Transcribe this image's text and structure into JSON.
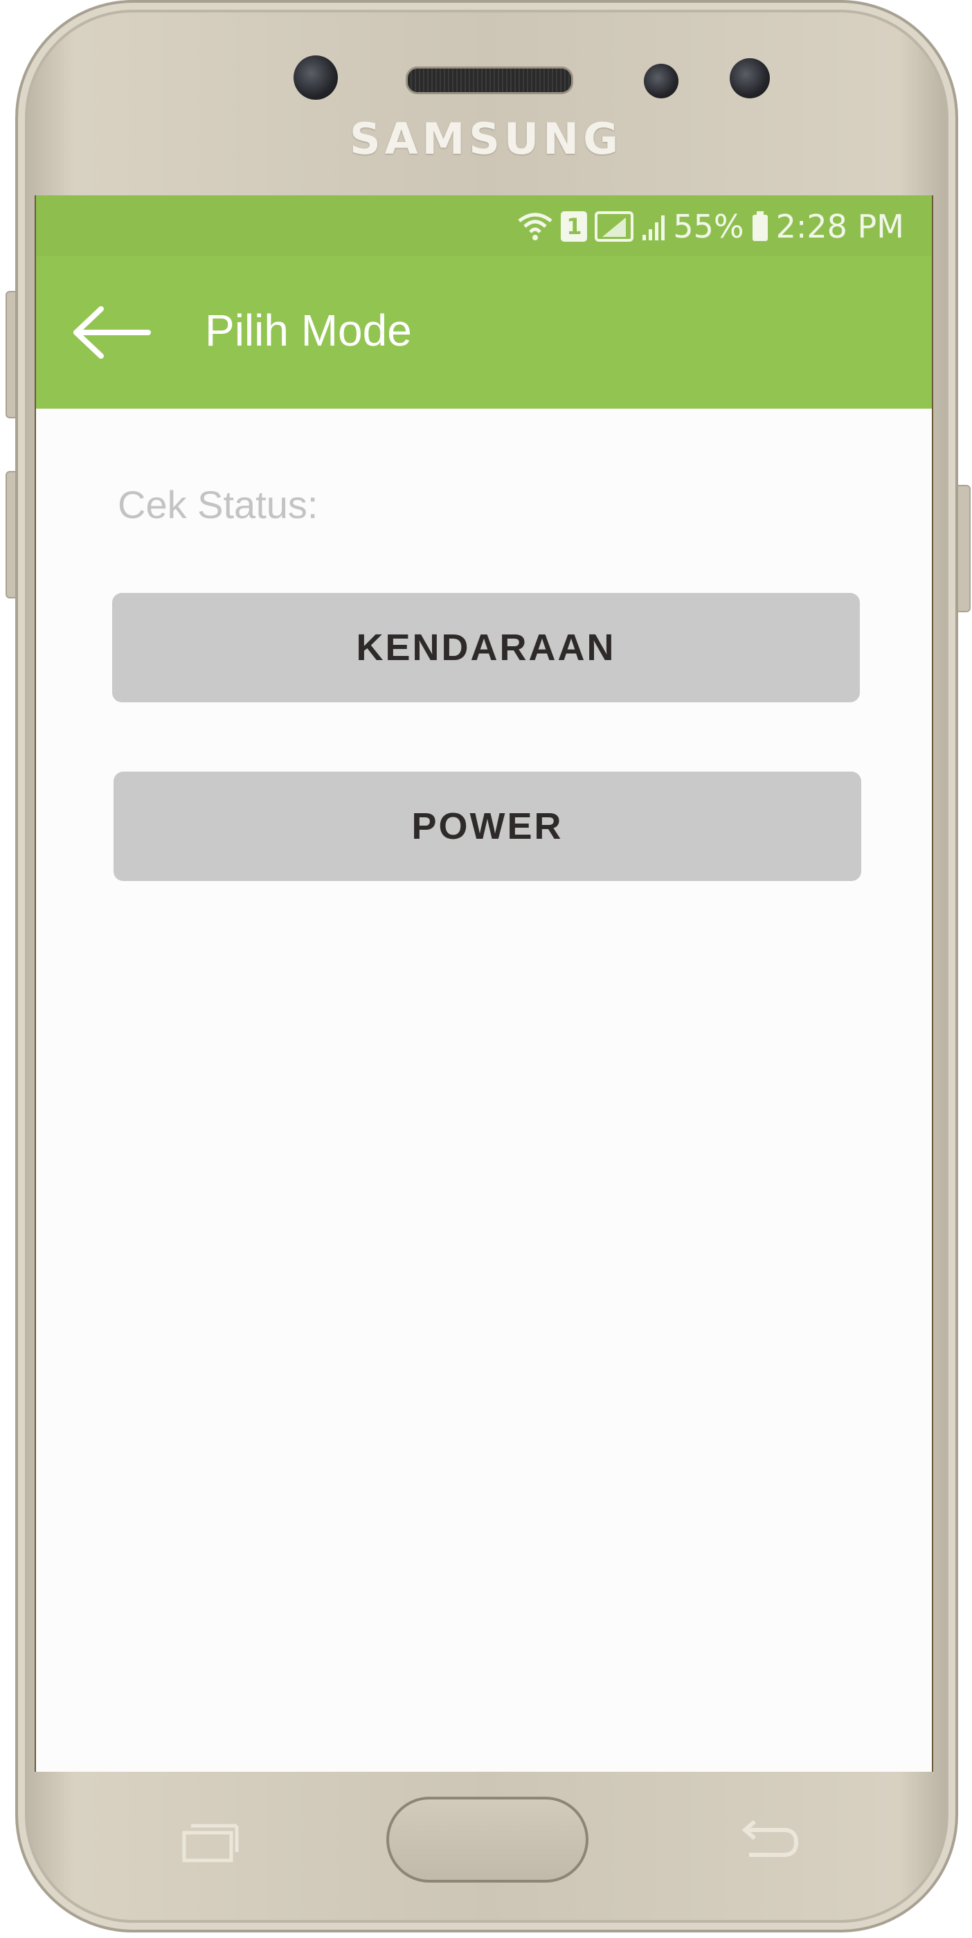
{
  "device": {
    "brand": "SAMSUNG"
  },
  "status_bar": {
    "battery": "55%",
    "time": "2:28 PM",
    "sim_badge": "1",
    "icons": [
      "wifi-icon",
      "sim-icon",
      "signal-icon",
      "signal-icon",
      "battery-icon"
    ]
  },
  "app_bar": {
    "title": "Pilih Mode",
    "back_icon": "arrow-left-icon",
    "color": "#92c452"
  },
  "main": {
    "status_label": "Cek Status:",
    "buttons": [
      {
        "label": "KENDARAAN"
      },
      {
        "label": "POWER"
      }
    ]
  },
  "nav_bar": {
    "icons": [
      "recent-apps-icon",
      "home-button",
      "back-icon"
    ]
  }
}
